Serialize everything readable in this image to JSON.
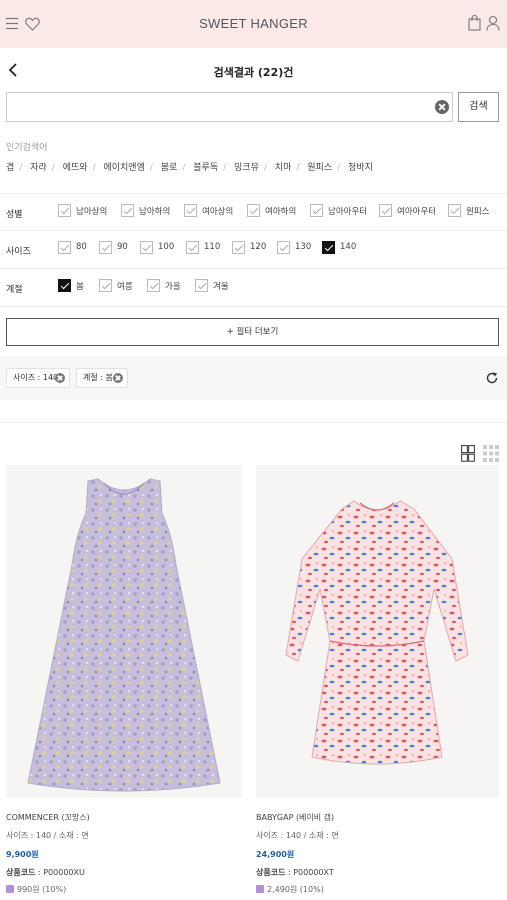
{
  "header": {
    "brand": "SWEET HANGER",
    "icons": [
      "menu-icon",
      "heart-icon",
      "shopping-bag-icon",
      "user-icon"
    ],
    "background": "#fbe9e7"
  },
  "titlebar": {
    "title": "검색결과 (22)건"
  },
  "search": {
    "value": "",
    "placeholder": "",
    "button_label": "검색"
  },
  "popular": {
    "label": "인기검색어",
    "keywords": [
      "겹",
      "자라",
      "에뜨와",
      "에이치앤엠",
      "봄로",
      "블루독",
      "밍크뮤",
      "치마",
      "원피스",
      "청바지"
    ]
  },
  "filters": [
    {
      "label": "성별",
      "options": [
        {
          "label": "남아상의",
          "checked": false
        },
        {
          "label": "남아하의",
          "checked": false
        },
        {
          "label": "여아상의",
          "checked": false
        },
        {
          "label": "여아하의",
          "checked": false
        },
        {
          "label": "남아아우터",
          "checked": false
        },
        {
          "label": "여아아우터",
          "checked": false
        },
        {
          "label": "원피스",
          "checked": false
        }
      ]
    },
    {
      "label": "사이즈",
      "options": [
        {
          "label": "80",
          "checked": false
        },
        {
          "label": "90",
          "checked": false
        },
        {
          "label": "100",
          "checked": false
        },
        {
          "label": "110",
          "checked": false
        },
        {
          "label": "120",
          "checked": false
        },
        {
          "label": "130",
          "checked": false
        },
        {
          "label": "140",
          "checked": true
        }
      ]
    },
    {
      "label": "계절",
      "options": [
        {
          "label": "봄",
          "checked": true
        },
        {
          "label": "여름",
          "checked": false
        },
        {
          "label": "가을",
          "checked": false
        },
        {
          "label": "겨울",
          "checked": false
        }
      ]
    }
  ],
  "more_filter_label": "+ 필터 더보기",
  "active_tags": [
    "사이즈 : 140",
    "계절 : 봄"
  ],
  "products": [
    {
      "brand": "COMMENCER (꼬망스)",
      "spec": "사이즈 : 140 / 소재 : 면",
      "price": "9,900원",
      "code_label": "상품코드",
      "code": " : P00000XU",
      "point": "990원 (10%)",
      "dress_color": "#c9c0dc"
    },
    {
      "brand": "BABYGAP (베이비 갭)",
      "spec": "사이즈 : 140 / 소재 : 면",
      "price": "24,900원",
      "code_label": "상품코드",
      "code": " : P00000XT",
      "point": "2,490원 (10%)",
      "dress_color": "#f3c5c8"
    }
  ],
  "colors": {
    "price": "#1e5fa8",
    "point_badge": "#b48fd6",
    "checked": "#111111"
  }
}
